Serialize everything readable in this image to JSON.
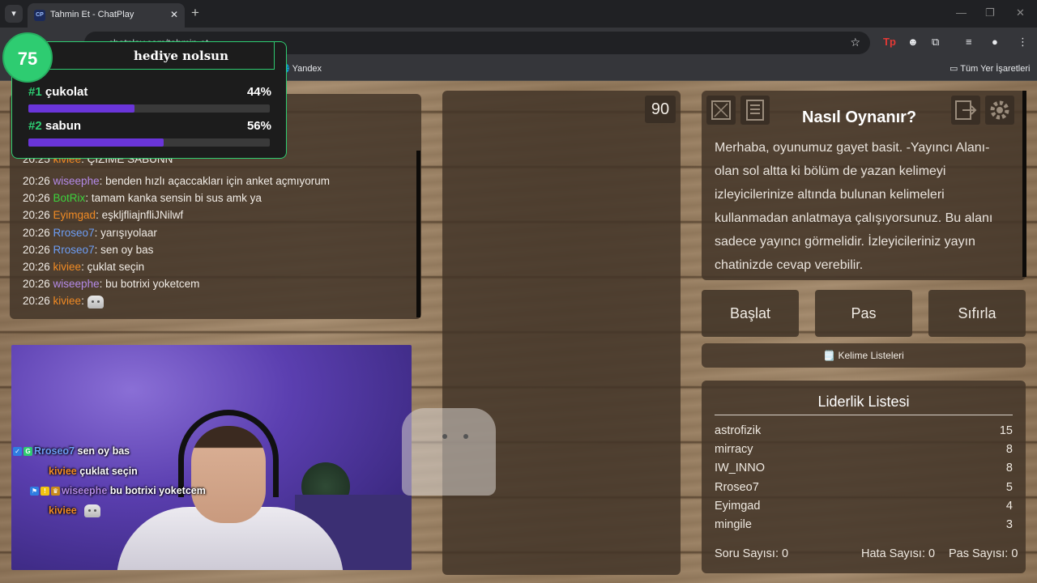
{
  "browser": {
    "tab_title": "Tahmin Et - ChatPlay",
    "tab_favicon": "CP",
    "address": "chatplay.com/tahmin-et",
    "bookmarks": {
      "yandex": "Yandex",
      "all_bookmarks": "Tüm Yer İşaretleri"
    }
  },
  "poll": {
    "timer": "75",
    "title": "hediye nolsun",
    "options": [
      {
        "rank": "#1",
        "label": "çukolat",
        "percent_label": "44%",
        "percent": 44
      },
      {
        "rank": "#2",
        "label": "sabun",
        "percent_label": "56%",
        "percent": 56
      }
    ],
    "accent_color": "#2ecc71",
    "bar_color": "#6a35d9"
  },
  "chat": {
    "partial_line": {
      "time": "20:25",
      "user": "kiviee",
      "text": ": ÇİZİME SABUNN"
    },
    "lines": [
      {
        "time": "20:26",
        "user": "wiseephe",
        "color": "#b48ae8",
        "text": ": benden hızlı açaccakları için anket açmıyorum"
      },
      {
        "time": "20:26",
        "user": "BotRix",
        "color": "#3dd23d",
        "text": ": tamam kanka sensin bi sus amk ya"
      },
      {
        "time": "20:26",
        "user": "Eyimgad",
        "color": "#f08a24",
        "text": ": eşkljfliajnfliJNilwf"
      },
      {
        "time": "20:26",
        "user": "Rroseo7",
        "color": "#6d9ef5",
        "text": ": yarışıyolaar"
      },
      {
        "time": "20:26",
        "user": "Rroseo7",
        "color": "#6d9ef5",
        "text": ": sen oy bas"
      },
      {
        "time": "20:26",
        "user": "kiviee",
        "color": "#f08a24",
        "text": ": çuklat seçin"
      },
      {
        "time": "20:26",
        "user": "wiseephe",
        "color": "#b48ae8",
        "text": ": bu botrixi yoketcem"
      },
      {
        "time": "20:26",
        "user": "kiviee",
        "color": "#f08a24",
        "text": ":"
      }
    ]
  },
  "webcam_chat": [
    {
      "user": "Rroseo7",
      "color": "#6d9ef5",
      "text": "sen oy bas"
    },
    {
      "user": "kiviee",
      "color": "#f08a24",
      "text": "çuklat seçin"
    },
    {
      "user": "wiseephe",
      "color": "#b48ae8",
      "text": "bu botrixi yoketcem"
    },
    {
      "user": "kiviee",
      "color": "#f08a24",
      "text": ""
    }
  ],
  "drawing": {
    "counter": "90"
  },
  "howto": {
    "title": "Nasıl Oynanır?",
    "text": "Merhaba, oyunumuz gayet basit. -Yayıncı Alanı- olan sol altta ki bölüm de yazan kelimeyi izleyicilerinize altında bulunan kelimeleri kullanmadan anlatmaya çalışıyorsunuz. Bu alanı sadece yayıncı görmelidir. İzleyicileriniz yayın chatinizde cevap verebilir."
  },
  "controls": {
    "start": "Başlat",
    "pass": "Pas",
    "reset": "Sıfırla",
    "word_lists": "Kelime Listeleri"
  },
  "leaderboard": {
    "title": "Liderlik Listesi",
    "rows": [
      {
        "name": "astrofizik",
        "score": "15"
      },
      {
        "name": "mirracy",
        "score": "8"
      },
      {
        "name": "IW_INNO",
        "score": "8"
      },
      {
        "name": "Rroseo7",
        "score": "5"
      },
      {
        "name": "Eyimgad",
        "score": "4"
      },
      {
        "name": "mingile",
        "score": "3"
      }
    ],
    "question_count": "Soru Sayısı: 0",
    "error_count": "Hata Sayısı: 0",
    "pass_count": "Pas Sayısı: 0"
  }
}
